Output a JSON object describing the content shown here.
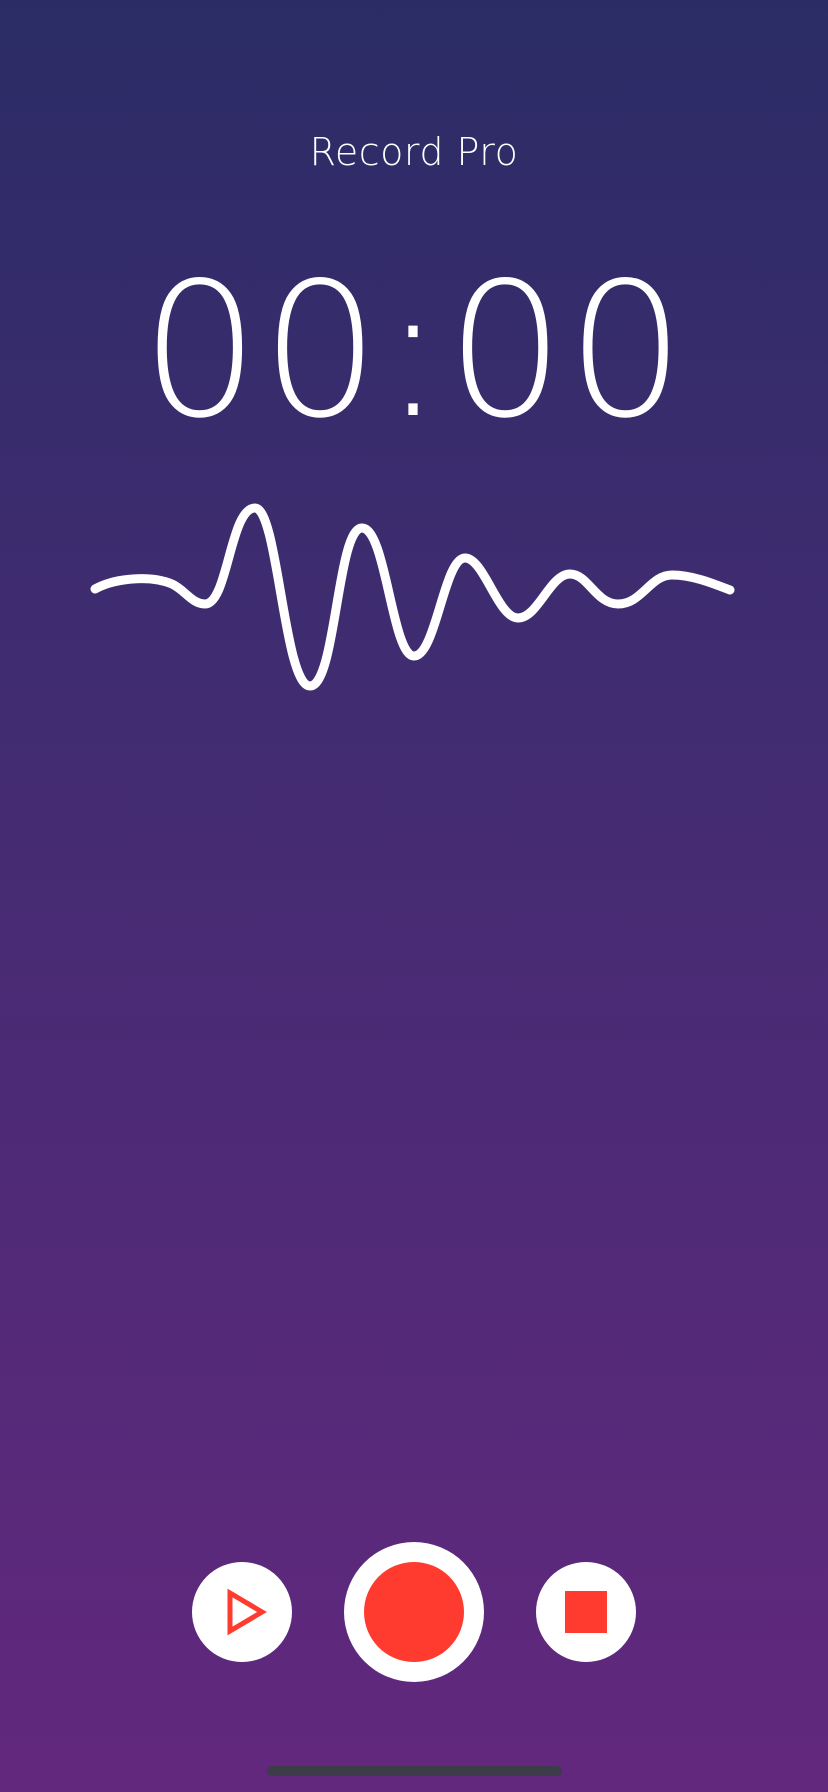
{
  "app": {
    "title": "Record Pro"
  },
  "timer": {
    "display": "00:00"
  },
  "controls": {
    "play_icon": "play-icon",
    "record_icon": "record-icon",
    "stop_icon": "stop-icon"
  },
  "colors": {
    "accent": "#ff3b30",
    "foreground": "#ffffff",
    "background_top": "#2b2c66",
    "background_bottom": "#62287e"
  }
}
